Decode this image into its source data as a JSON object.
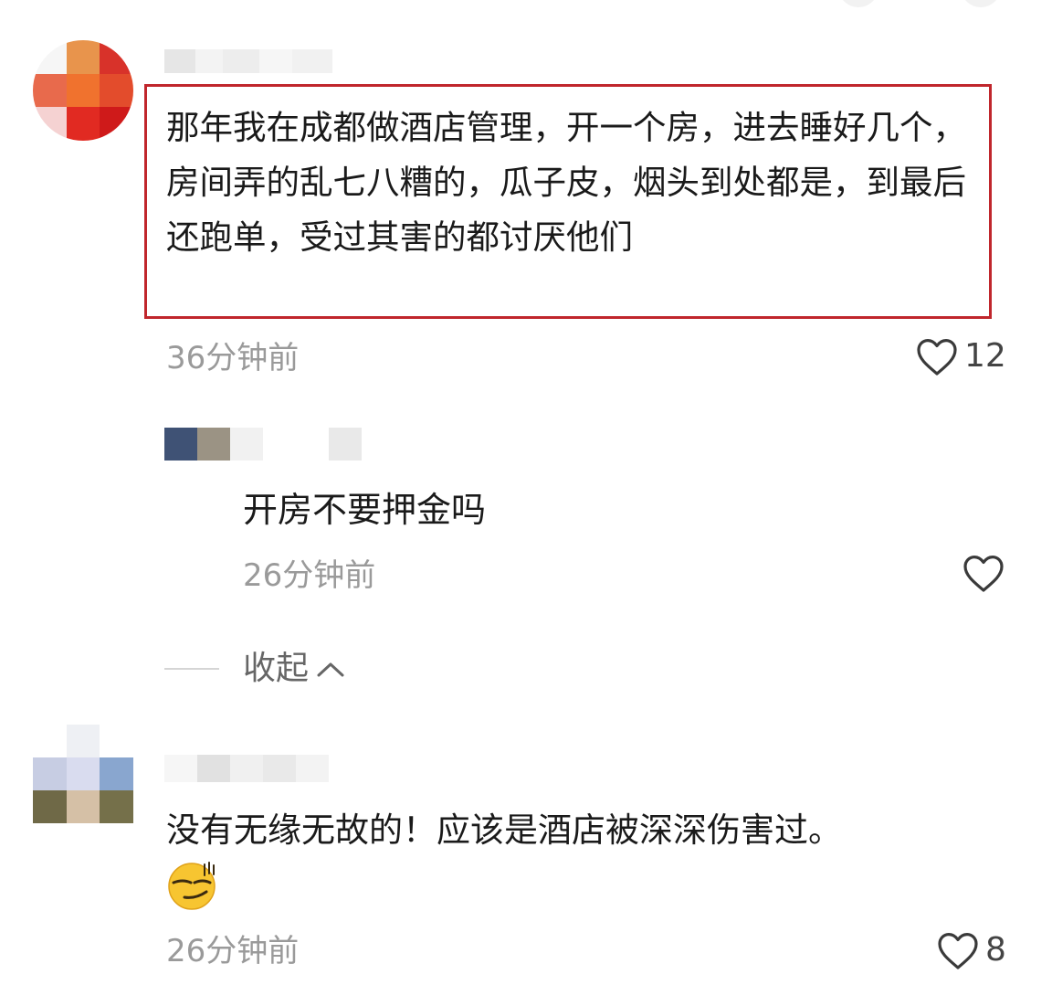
{
  "comments": [
    {
      "text": "那年我在成都做酒店管理，开一个房，进去睡好几个，房间弄的乱七八糟的，瓜子皮，烟头到处都是，到最后还跑单，受过其害的都讨厌他们",
      "time": "36分钟前",
      "likes": "12"
    },
    {
      "text": "没有无缘无故的！应该是酒店被深深伤害过。",
      "time": "26分钟前",
      "likes": "8",
      "emoji": "smirk-emoji"
    }
  ],
  "reply": {
    "text": "开房不要押金吗",
    "time": "26分钟前"
  },
  "collapse": {
    "label": "收起"
  },
  "colors": {
    "highlight_border": "#c0262c",
    "timestamp": "#9a9a9a",
    "text": "#1a1a1a"
  }
}
